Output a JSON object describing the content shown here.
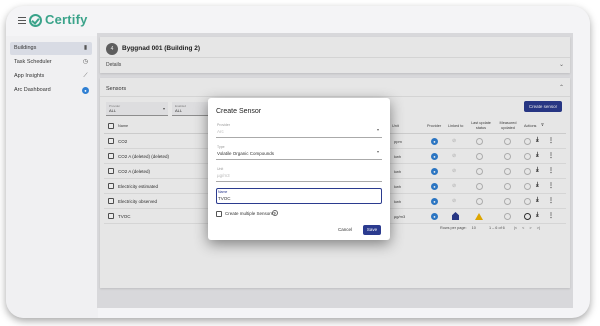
{
  "app": {
    "logo_text": "Certify",
    "brand_color": "#3aa38a",
    "accent": "#2b3b8f"
  },
  "sidebar": {
    "items": [
      {
        "label": "Buildings",
        "icon": "building-icon"
      },
      {
        "label": "Task Scheduler",
        "icon": "clock-icon"
      },
      {
        "label": "App Insights",
        "icon": "chart-icon"
      },
      {
        "label": "Arc Dashboard",
        "icon": "arc-icon"
      }
    ]
  },
  "building": {
    "number": "4",
    "title": "Byggnad 001 (Building 2)",
    "details_label": "Details"
  },
  "sensors": {
    "title": "Sensors",
    "filters": [
      {
        "label": "Provider",
        "value": "ALL"
      },
      {
        "label": "Enabled",
        "value": "ALL"
      }
    ],
    "create_label": "Create sensor",
    "columns": [
      "Name",
      "Unit",
      "Provider",
      "Linked to",
      "Last update status",
      "Measured updated",
      "Actions"
    ],
    "rows": [
      {
        "name": "CO2",
        "unit": "ppm"
      },
      {
        "name": "CO2 A (deleted) (deleted)",
        "unit": "kwh"
      },
      {
        "name": "CO2 A (deleted)",
        "unit": "kwh"
      },
      {
        "name": "Electricity estimated",
        "unit": "kwh"
      },
      {
        "name": "Electricity observed",
        "unit": "kwh"
      },
      {
        "name": "TVOC",
        "unit": "µg/m3"
      }
    ],
    "pager": {
      "rows_label": "Rows per page:",
      "rows_value": "10",
      "range": "1 – 6 of 6"
    }
  },
  "dialog": {
    "title": "Create Sensor",
    "provider_label": "Provider",
    "provider_value": "Arc",
    "type_label": "Type",
    "type_value": "Volatile Organic Compounds",
    "unit_label": "Unit",
    "unit_value": "µg/m3",
    "name_label": "Name",
    "name_value": "TVOC",
    "multiple_label": "Create multiple Sensors?",
    "cancel_label": "Cancel",
    "save_label": "Save"
  }
}
